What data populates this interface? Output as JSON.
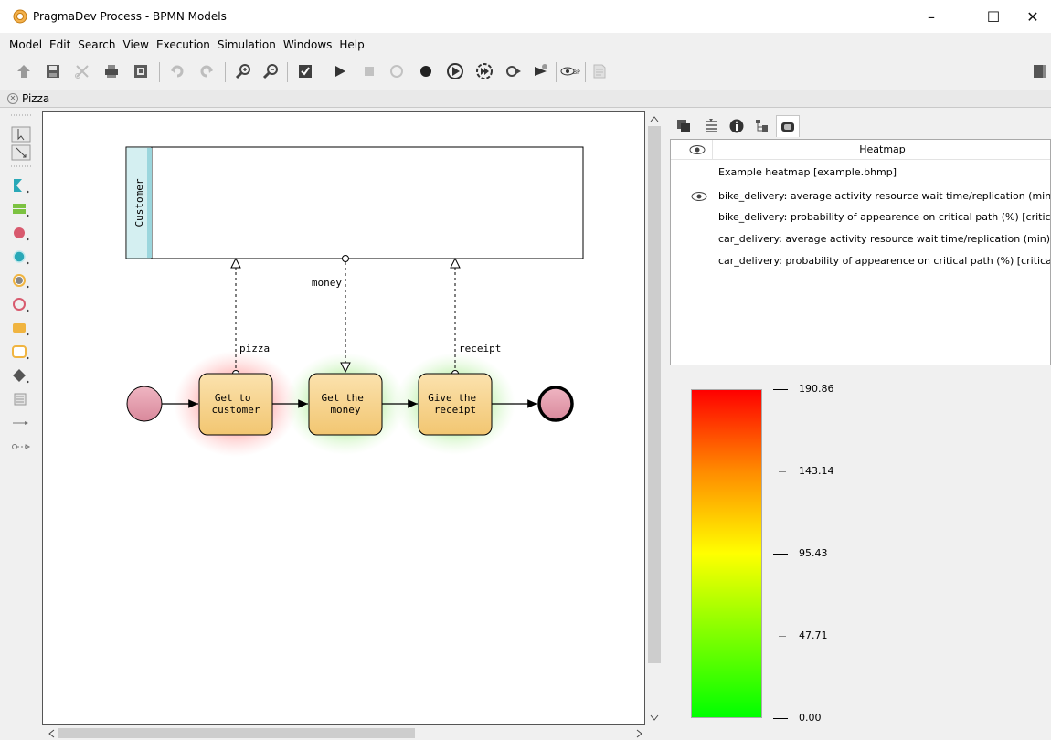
{
  "window": {
    "title": "PragmaDev Process - BPMN Models",
    "minimize_symbol": "–",
    "maximize_symbol": "☐",
    "close_symbol": "✕"
  },
  "menu": [
    "Model",
    "Edit",
    "Search",
    "View",
    "Execution",
    "Simulation",
    "Windows",
    "Help"
  ],
  "tab": {
    "label": "Pizza"
  },
  "diagram": {
    "lane_label": "Customer",
    "tasks": [
      "Get to\ncustomer",
      "Get the\nmoney",
      "Give the\nreceipt"
    ],
    "flows": [
      "pizza",
      "money",
      "receipt"
    ],
    "heat_colors": {
      "task1": "#ff6b6b",
      "task2": "#7ddc5a",
      "task3": "#7ddc5a"
    }
  },
  "panel": {
    "list_header": "Heatmap",
    "rows": [
      "Example heatmap [example.bhmp]",
      "bike_delivery: average activity resource wait time/replication (min) [resource_wait]",
      "bike_delivery: probability of appearence on critical path (%) [critical_path]",
      "car_delivery: average activity resource wait time/replication (min) [resource_wait]",
      "car_delivery: probability of appearence on critical path (%) [critical_path]"
    ],
    "legend": {
      "ticks": [
        "190.86",
        "143.14",
        "95.43",
        "47.71",
        "0.00"
      ],
      "gradient": [
        "#ff0000",
        "#ff8c00",
        "#ffff00",
        "#7fff00",
        "#00ff00"
      ]
    }
  },
  "colors": {
    "task_fill": "#f6d38c",
    "event_fill": "#e8a0b0",
    "lane_header": "#d4eff1"
  },
  "icons": {
    "toolbar": [
      "up-arrow-icon",
      "save-icon",
      "cut-icon",
      "print-icon",
      "export-icon",
      "undo-icon",
      "redo-icon",
      "zoom-in-icon",
      "zoom-out-icon",
      "check-icon",
      "play-icon",
      "stop-icon",
      "restart-icon",
      "record-icon",
      "step-icon",
      "fast-step-icon",
      "breakpoint-icon",
      "eye-bp-icon",
      "simulation-icon",
      "side-panel-icon"
    ],
    "panel_tabs": [
      "layers-icon",
      "list-icon",
      "info-icon",
      "tree-icon",
      "heatmap-icon"
    ]
  }
}
